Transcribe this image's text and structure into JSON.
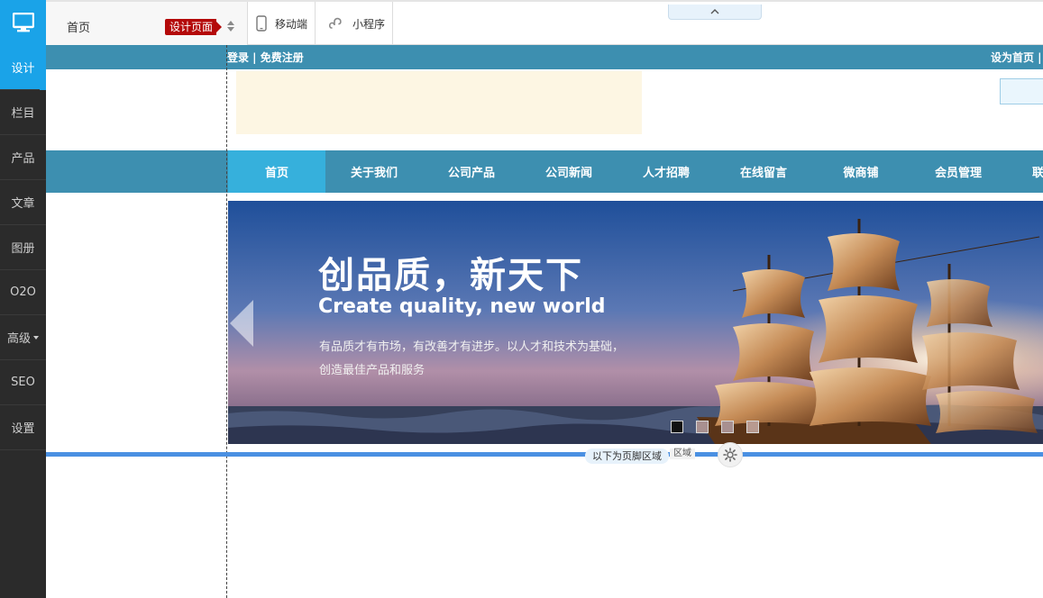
{
  "sidebar": {
    "logo_icon": "monitor-icon",
    "items": [
      {
        "label": "设计"
      },
      {
        "label": "栏目"
      },
      {
        "label": "产品"
      },
      {
        "label": "文章"
      },
      {
        "label": "图册"
      },
      {
        "label": "O2O"
      },
      {
        "label": "高级"
      },
      {
        "label": "SEO"
      },
      {
        "label": "设置"
      }
    ],
    "add_symbol": "+"
  },
  "toolbar": {
    "page_select": "首页",
    "design_badge": "设计页面",
    "mobile_label": "移动端",
    "miniprogram_label": "小程序"
  },
  "site": {
    "login_text": "登录 |  免费注册",
    "sethome_text": "设为首页 |",
    "nav": [
      {
        "label": "首页"
      },
      {
        "label": "关于我们"
      },
      {
        "label": "公司产品"
      },
      {
        "label": "公司新闻"
      },
      {
        "label": "人才招聘"
      },
      {
        "label": "在线留言"
      },
      {
        "label": "微商铺"
      },
      {
        "label": "会员管理"
      },
      {
        "label": "联"
      }
    ],
    "banner": {
      "title": "创品质，新天下",
      "subtitle": "Create quality, new world",
      "desc_line1": "有品质才有市场，有改善才有进步。以人才和技术为基础，",
      "desc_line2": "创造最佳产品和服务",
      "slides": 4,
      "active_slide": 1
    },
    "footer_label": "以下为页脚区域",
    "footer_label_partial": "区域"
  },
  "colors": {
    "accent": "#1aa3e8",
    "sidebar_bg": "#2b2b2b",
    "site_bar": "#3d8fb0",
    "nav_active": "#36b0dc",
    "badge": "#b40a0a",
    "footer_line": "#4a90e2"
  }
}
